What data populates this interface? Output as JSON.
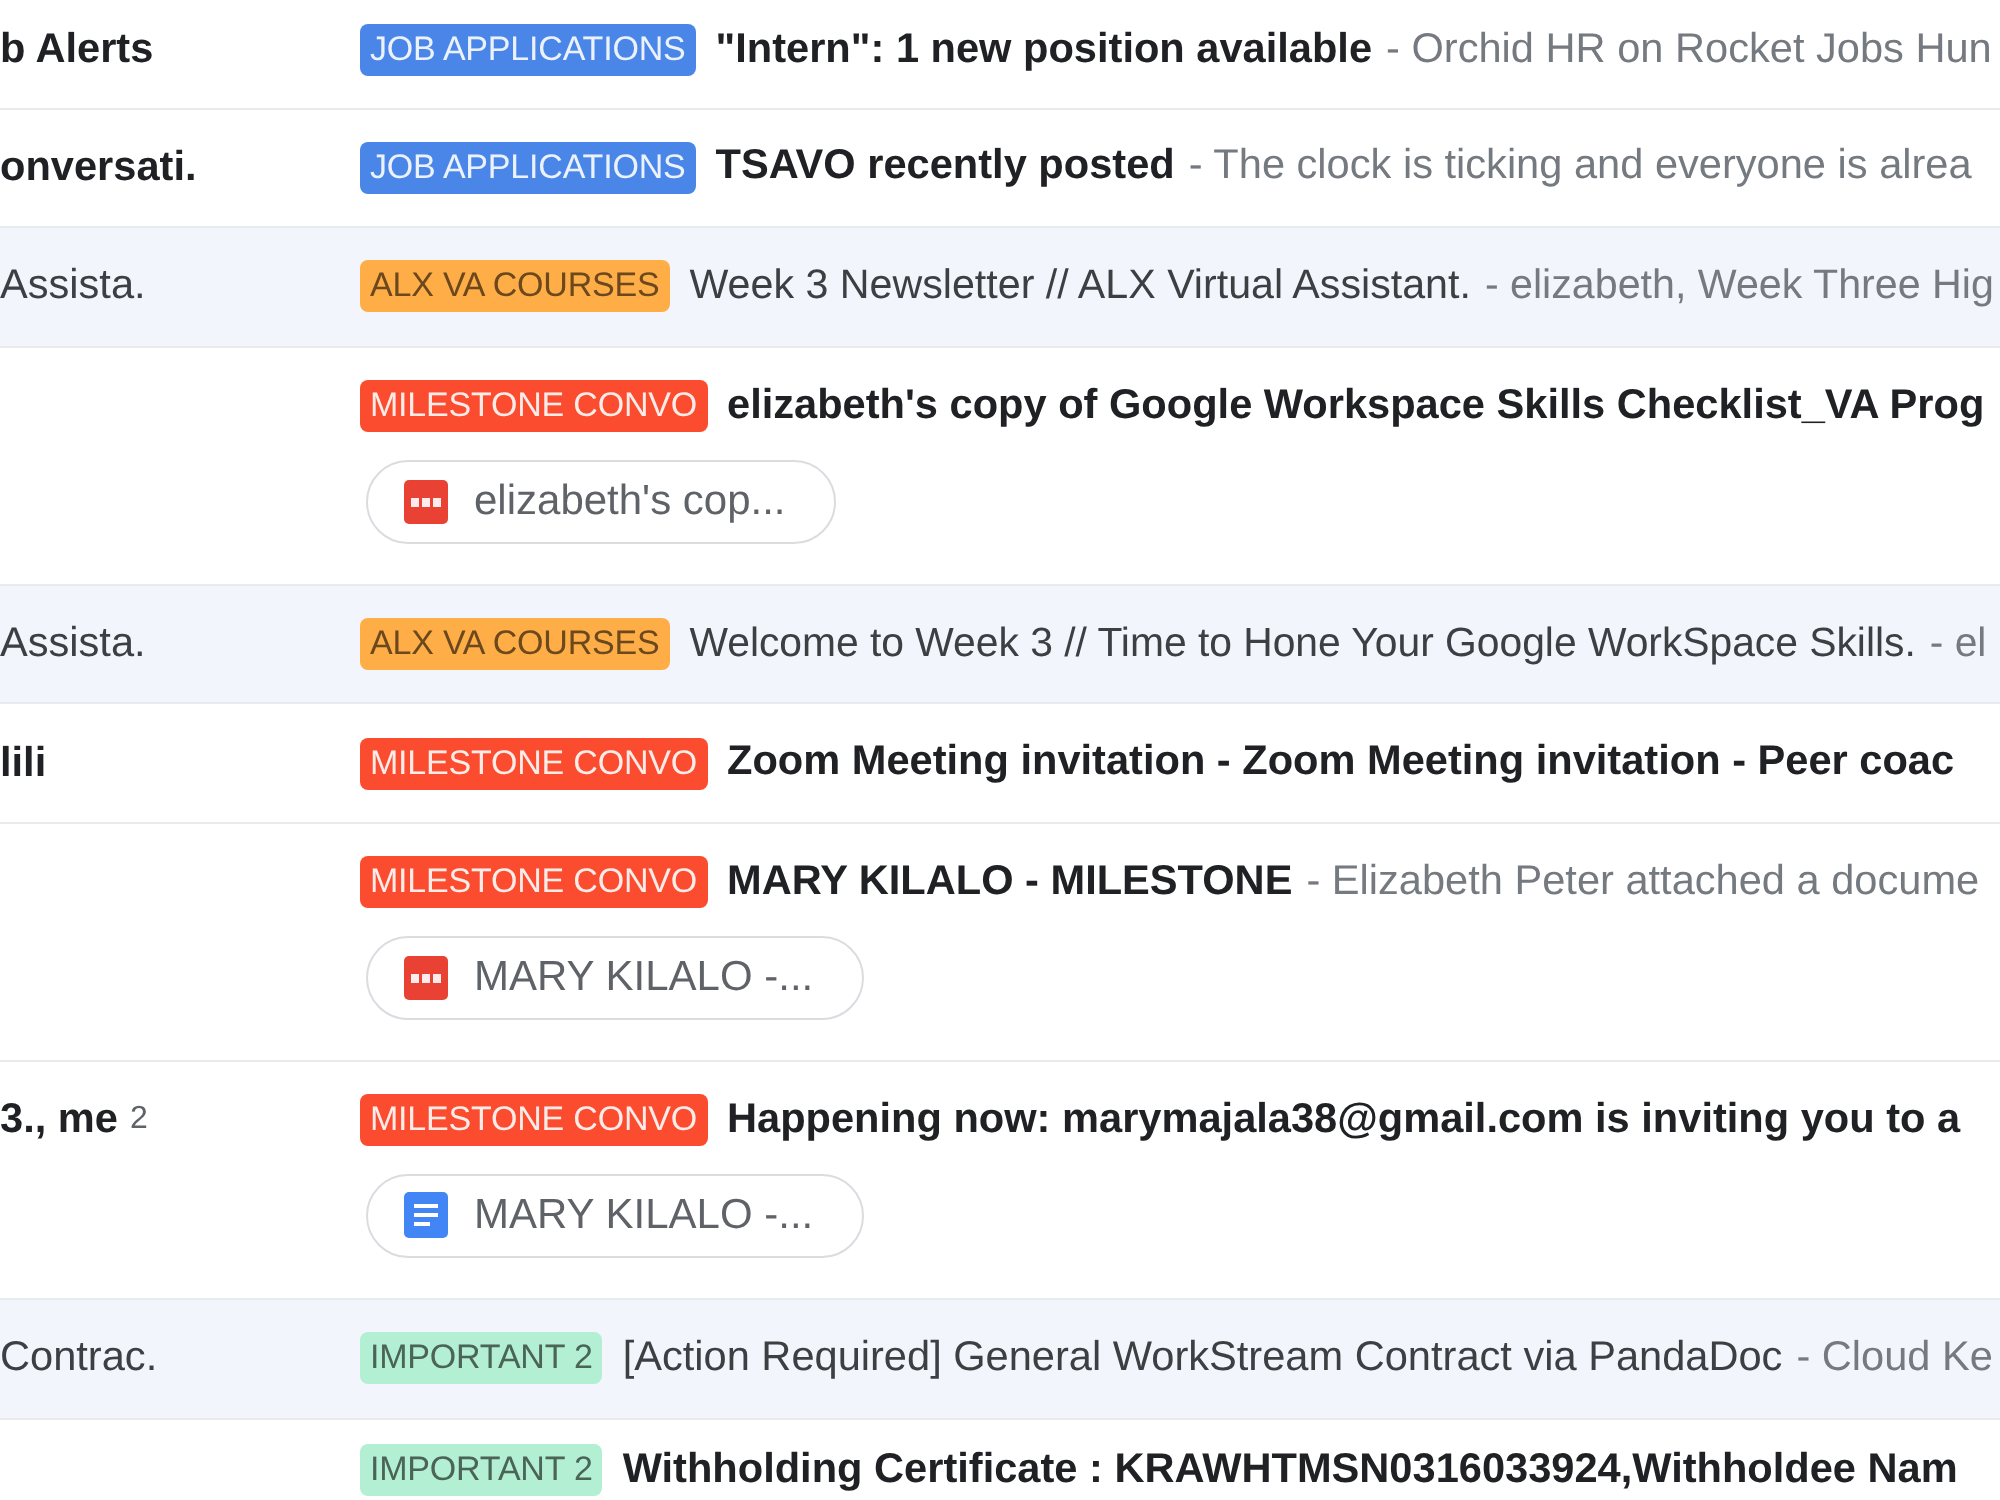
{
  "rows": [
    {
      "unread": true,
      "sender": "b Alerts",
      "label": {
        "text": "JOB APPLICATIONS",
        "color": "#4a86e8"
      },
      "subject": "\"Intern\": 1 new position available",
      "snippet": "- Orchid HR on Rocket Jobs Hun"
    },
    {
      "unread": true,
      "sender": "onversati.",
      "label": {
        "text": "JOB APPLICATIONS",
        "color": "#4a86e8"
      },
      "subject": "TSAVO recently posted",
      "snippet": "- The clock is ticking and everyone is alrea"
    },
    {
      "unread": false,
      "sender": "Assista.",
      "label": {
        "text": "ALX VA COURSES",
        "color": "#ffad47"
      },
      "subject": "Week 3 Newsletter // ALX Virtual Assistant.",
      "snippet": "- elizabeth, Week Three Hig"
    },
    {
      "unread": true,
      "label": {
        "text": "MILESTONE CONVO",
        "color": "#fb4c2f"
      },
      "subject": "elizabeth's copy of Google Workspace Skills Checklist_VA Prog",
      "attachments": [
        {
          "kind": "pdf",
          "name": "elizabeth's cop..."
        }
      ]
    },
    {
      "unread": false,
      "sender": "Assista.",
      "label": {
        "text": "ALX VA COURSES",
        "color": "#ffad47"
      },
      "subject": "Welcome to Week 3 // Time to Hone Your Google WorkSpace Skills.",
      "snippet": "- el"
    },
    {
      "unread": true,
      "sender": "lili",
      "label": {
        "text": "MILESTONE CONVO",
        "color": "#fb4c2f"
      },
      "subject": "Zoom Meeting invitation - Zoom Meeting invitation - Peer coac"
    },
    {
      "unread": true,
      "label": {
        "text": "MILESTONE CONVO",
        "color": "#fb4c2f"
      },
      "subject": "MARY KILALO - MILESTONE",
      "snippet": "- Elizabeth Peter attached a docume",
      "attachments": [
        {
          "kind": "pdf",
          "name": "MARY KILALO -..."
        }
      ]
    },
    {
      "unread": true,
      "sender": "3., me",
      "count": "2",
      "label": {
        "text": "MILESTONE CONVO",
        "color": "#fb4c2f"
      },
      "subject": "Happening now: marymajala38@gmail.com is inviting you to a",
      "attachments": [
        {
          "kind": "doc",
          "name": "MARY KILALO -..."
        }
      ]
    },
    {
      "unread": false,
      "sender": "Contrac.",
      "label": {
        "text": "IMPORTANT 2",
        "color": "#b3efd3"
      },
      "subject": "[Action Required] General WorkStream Contract via PandaDoc",
      "snippet": "- Cloud Ke"
    },
    {
      "unread": true,
      "label": {
        "text": "IMPORTANT 2",
        "color": "#b3efd3"
      },
      "subject": "Withholding Certificate : KRAWHTMSN0316033924,Withholdee Nam"
    }
  ]
}
